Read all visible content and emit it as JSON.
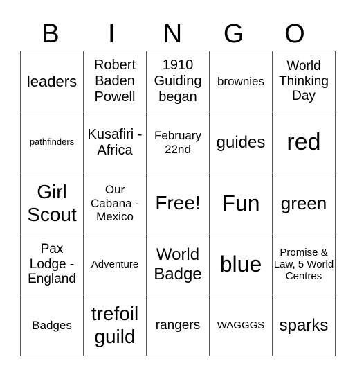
{
  "header": [
    "B",
    "I",
    "N",
    "G",
    "O"
  ],
  "rows": [
    [
      {
        "text": "leaders",
        "size": "s22"
      },
      {
        "text": "Robert Baden Powell",
        "size": "s20"
      },
      {
        "text": "1910 Guiding began",
        "size": "s20"
      },
      {
        "text": "brownies",
        "size": "s17"
      },
      {
        "text": "World Thinking Day",
        "size": "s19"
      }
    ],
    [
      {
        "text": "pathfinders",
        "size": "s13"
      },
      {
        "text": "Kusafiri - Africa",
        "size": "s20"
      },
      {
        "text": "February 22nd",
        "size": "s17"
      },
      {
        "text": "guides",
        "size": "s24"
      },
      {
        "text": "red",
        "size": "s34"
      }
    ],
    [
      {
        "text": "Girl Scout",
        "size": "s28"
      },
      {
        "text": "Our Cabana - Mexico",
        "size": "s17"
      },
      {
        "text": "Free!",
        "size": "s28"
      },
      {
        "text": "Fun",
        "size": "s32"
      },
      {
        "text": "green",
        "size": "s26"
      }
    ],
    [
      {
        "text": "Pax Lodge - England",
        "size": "s19"
      },
      {
        "text": "Adventure",
        "size": "s15"
      },
      {
        "text": "World Badge",
        "size": "s24"
      },
      {
        "text": "blue",
        "size": "s32"
      },
      {
        "text": "Promise & Law, 5 World Centres",
        "size": "s15"
      }
    ],
    [
      {
        "text": "Badges",
        "size": "s17"
      },
      {
        "text": "trefoil guild",
        "size": "s28"
      },
      {
        "text": "rangers",
        "size": "s19"
      },
      {
        "text": "WAGGGS",
        "size": "s15"
      },
      {
        "text": "sparks",
        "size": "s24"
      }
    ]
  ]
}
